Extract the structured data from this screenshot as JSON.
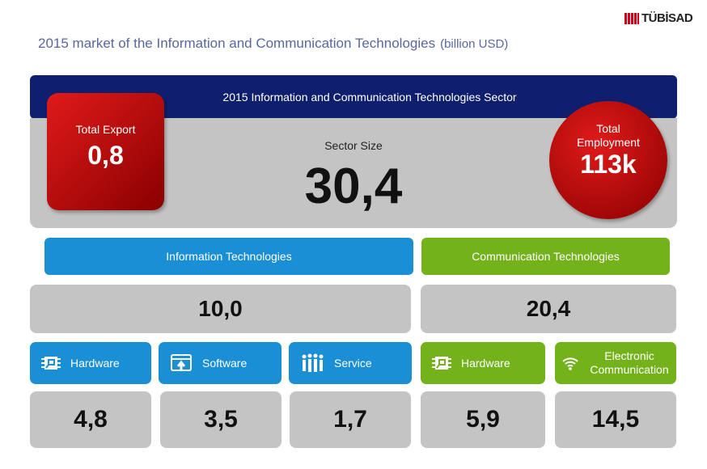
{
  "title": "2015 market of the Information and Communication Technologies",
  "title_unit": "(billion USD)",
  "logo": "TÜBİSAD",
  "sector": {
    "header": "2015 Information and Communication Technologies Sector",
    "size_label": "Sector Size",
    "size_value": "30,4"
  },
  "export": {
    "label": "Total Export",
    "value": "0,8"
  },
  "employment": {
    "label_line1": "Total",
    "label_line2": "Employment",
    "value": "113k"
  },
  "it": {
    "label": "Information Technologies",
    "value": "10,0",
    "items": [
      {
        "label": "Hardware",
        "value": "4,8",
        "icon": "chip-icon"
      },
      {
        "label": "Software",
        "value": "3,5",
        "icon": "software-upload-icon"
      },
      {
        "label": "Service",
        "value": "1,7",
        "icon": "people-icon"
      }
    ]
  },
  "ct": {
    "label": "Communication Technologies",
    "value": "20,4",
    "items": [
      {
        "label": "Hardware",
        "value": "5,9",
        "icon": "chip-icon"
      },
      {
        "label": "Electronic Communication",
        "value": "14,5",
        "icon": "wifi-icon"
      }
    ]
  },
  "colors": {
    "navy": "#0f1f6e",
    "red": "#c00000",
    "blue": "#1a8fd6",
    "green": "#74b21c",
    "gray": "#c4c4c4"
  }
}
